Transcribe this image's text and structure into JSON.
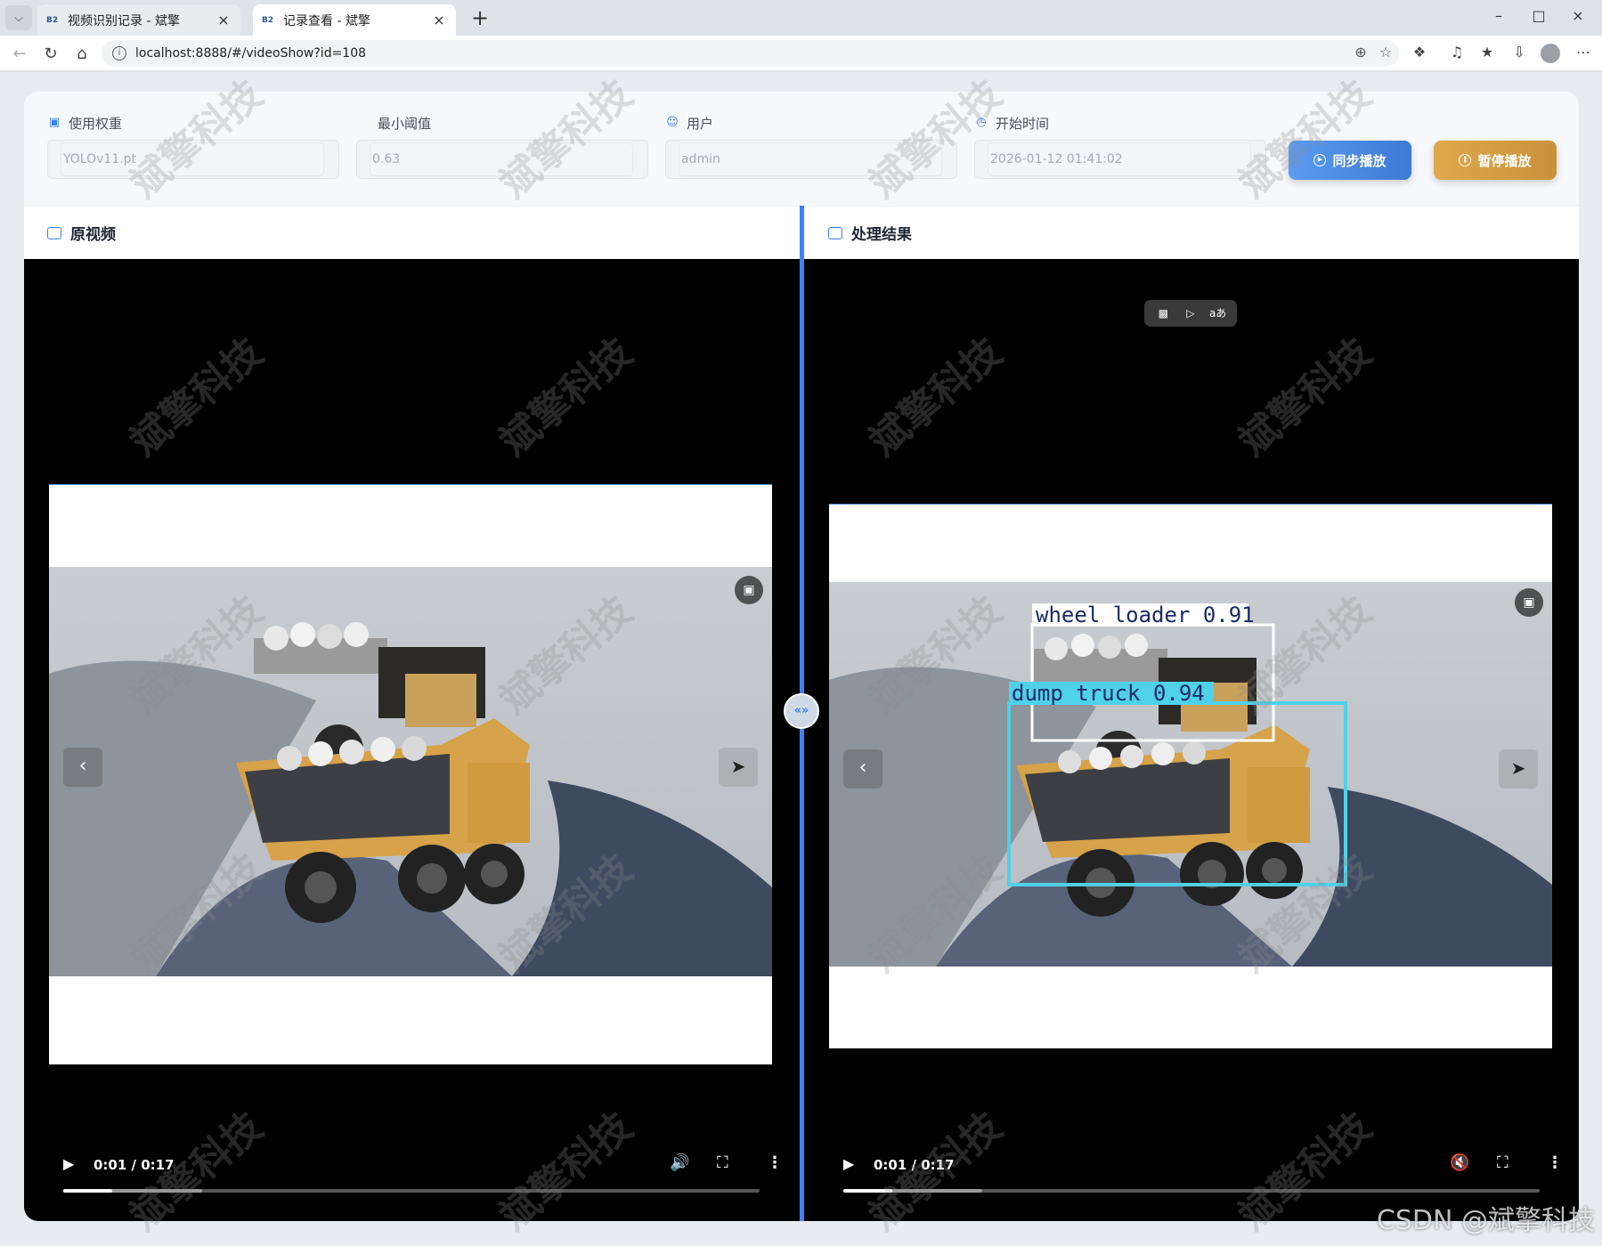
{
  "browser": {
    "tabs": [
      {
        "favicon": "B2",
        "title": "视频识别记录 - 斌擎",
        "active": false
      },
      {
        "favicon": "B2",
        "title": "记录查看 - 斌擎",
        "active": true
      }
    ],
    "url": "localhost:8888/#/videoShow?id=108"
  },
  "filters": {
    "weight": {
      "label": "使用权重",
      "value": "YOLOv11.pt",
      "icon": "chip-icon"
    },
    "threshold": {
      "label": "最小阈值",
      "value": "0.63"
    },
    "user": {
      "label": "用户",
      "value": "admin",
      "icon": "user-icon"
    },
    "start_time": {
      "label": "开始时间",
      "value": "2026-01-12 01:41:02",
      "icon": "clock-icon"
    }
  },
  "buttons": {
    "sync": "同步播放",
    "pause": "暂停播放"
  },
  "panes": {
    "original": {
      "title": "原视频",
      "time": "0:01 / 0:17",
      "progress": 0.07,
      "buffered": 0.2
    },
    "result": {
      "title": "处理结果",
      "time": "0:01 / 0:17",
      "progress": 0.07,
      "buffered": 0.2,
      "detections": [
        {
          "label": "wheel loader 0.91"
        },
        {
          "label": "dump truck 0.94"
        }
      ]
    }
  },
  "watermark": "斌擎科技",
  "footer_credit": "CSDN @斌擎科技",
  "colors": {
    "accent": "#3b82f6",
    "sync_button": "#4a8ae6",
    "pause_button": "#d49e44",
    "box_loader": "#ffffff",
    "box_truck": "#4fd1e8"
  }
}
